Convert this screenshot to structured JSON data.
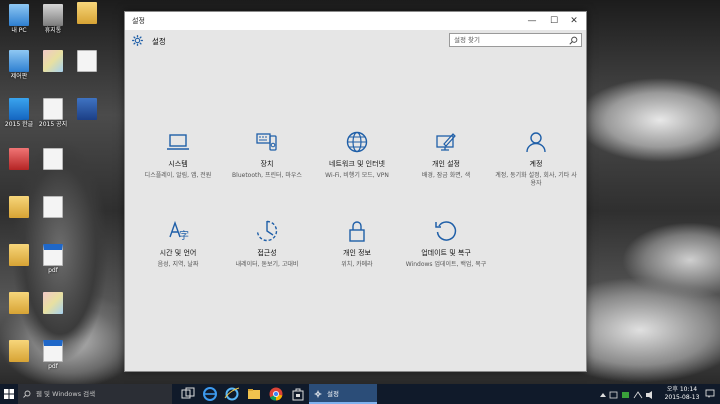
{
  "window": {
    "title": "설정",
    "minimize": "—",
    "maximize": "☐",
    "close": "✕"
  },
  "header": {
    "title": "설정",
    "search_placeholder": "설정 찾기"
  },
  "tiles": [
    {
      "title": "시스템",
      "desc": "디스플레이, 알림, 앱, 전원",
      "icon": "laptop-icon"
    },
    {
      "title": "장치",
      "desc": "Bluetooth, 프린터, 마우스",
      "icon": "devices-icon"
    },
    {
      "title": "네트워크 및 인터넷",
      "desc": "Wi-Fi, 비행기 모드, VPN",
      "icon": "globe-icon"
    },
    {
      "title": "개인 설정",
      "desc": "배경, 잠금 화면, 색",
      "icon": "personalization-icon"
    },
    {
      "title": "계정",
      "desc": "계정, 동기화 설정, 회사, 기타 사용자",
      "icon": "person-icon"
    },
    {
      "title": "시간 및 언어",
      "desc": "음성, 지역, 날짜",
      "icon": "time-language-icon"
    },
    {
      "title": "접근성",
      "desc": "내레이터, 돋보기, 고대비",
      "icon": "ease-of-access-icon"
    },
    {
      "title": "개인 정보",
      "desc": "위치, 카메라",
      "icon": "lock-icon"
    },
    {
      "title": "업데이트 및 복구",
      "desc": "Windows 업데이트, 백업, 복구",
      "icon": "update-icon"
    }
  ],
  "taskbar": {
    "search_text": "웹 및 Windows 검색",
    "active_app": "설정",
    "clock_period_time": "오후 10:14",
    "clock_date": "2015-08-13"
  },
  "desktop_icons": [
    {
      "label": "내 PC",
      "icon": "pc-icon"
    },
    {
      "label": "휴지통",
      "icon": "trash-icon"
    },
    {
      "label": "",
      "icon": "folder-icon"
    },
    {
      "label": "제어판",
      "icon": "control-panel-icon"
    },
    {
      "label": "",
      "icon": "image-icon"
    },
    {
      "label": "",
      "icon": "edge-icon"
    },
    {
      "label": "2015 한글",
      "icon": "word-icon"
    },
    {
      "label": "2015 공지",
      "icon": "doc-icon"
    },
    {
      "label": "",
      "icon": "zip-icon"
    },
    {
      "label": "",
      "icon": "red-app-icon"
    },
    {
      "label": "",
      "icon": "doc-icon"
    },
    {
      "label": "",
      "icon": "folder-icon"
    },
    {
      "label": "",
      "icon": "doc-icon"
    },
    {
      "label": "",
      "icon": "folder-icon"
    },
    {
      "label": "pdf",
      "icon": "pdf-icon"
    },
    {
      "label": "",
      "icon": "folder-icon"
    },
    {
      "label": "",
      "icon": "image-icon"
    },
    {
      "label": "",
      "icon": "folder-icon"
    },
    {
      "label": "pdf",
      "icon": "pdf-icon"
    }
  ]
}
